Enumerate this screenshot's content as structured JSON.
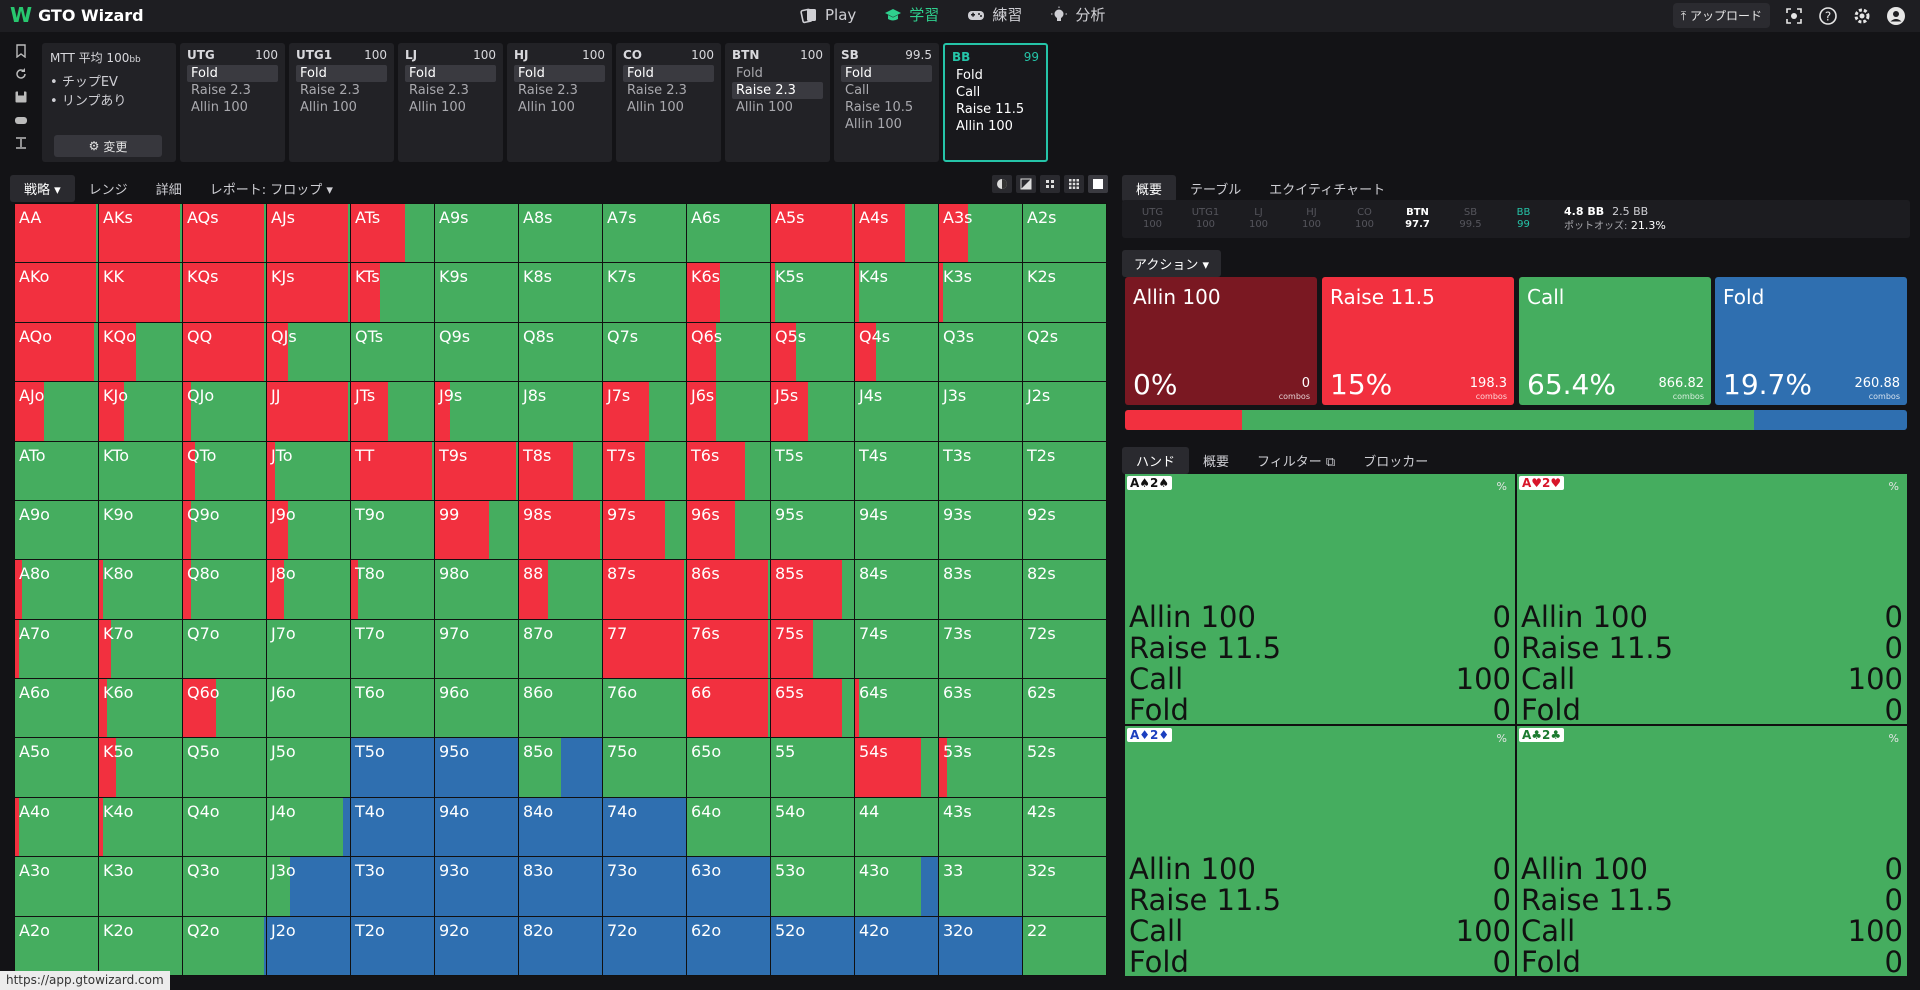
{
  "app": {
    "logo_text": "GTO Wizard"
  },
  "nav": [
    {
      "label": "Play",
      "icon": "cards-icon",
      "active": false
    },
    {
      "label": "学習",
      "icon": "graduation-cap-icon",
      "active": true
    },
    {
      "label": "練習",
      "icon": "gamepad-icon",
      "active": false
    },
    {
      "label": "分析",
      "icon": "bulb-icon",
      "active": false
    }
  ],
  "topright": {
    "upload_label": "アップロード"
  },
  "settings_card": {
    "title": "MTT 平均 100",
    "title_unit": "bb",
    "items": [
      "チップEV",
      "リンプあり"
    ],
    "change_label": "変更"
  },
  "positions": [
    {
      "name": "UTG",
      "stack": "100",
      "actions": [
        "Fold",
        "Raise 2.3",
        "Allin 100"
      ],
      "selected": 0
    },
    {
      "name": "UTG1",
      "stack": "100",
      "actions": [
        "Fold",
        "Raise 2.3",
        "Allin 100"
      ],
      "selected": 0
    },
    {
      "name": "LJ",
      "stack": "100",
      "actions": [
        "Fold",
        "Raise 2.3",
        "Allin 100"
      ],
      "selected": 0
    },
    {
      "name": "HJ",
      "stack": "100",
      "actions": [
        "Fold",
        "Raise 2.3",
        "Allin 100"
      ],
      "selected": 0
    },
    {
      "name": "CO",
      "stack": "100",
      "actions": [
        "Fold",
        "Raise 2.3",
        "Allin 100"
      ],
      "selected": 0
    },
    {
      "name": "BTN",
      "stack": "100",
      "actions": [
        "Fold",
        "Raise 2.3",
        "Allin 100"
      ],
      "selected": 1
    },
    {
      "name": "SB",
      "stack": "99.5",
      "actions": [
        "Fold",
        "Call",
        "Raise 10.5",
        "Allin 100"
      ],
      "selected": 0
    },
    {
      "name": "BB",
      "stack": "99",
      "actions": [
        "Fold",
        "Call",
        "Raise 11.5",
        "Allin 100"
      ],
      "selected": -1,
      "active": true
    }
  ],
  "left_tabs": [
    {
      "label": "戦略 ▾",
      "active": true
    },
    {
      "label": "レンジ",
      "active": false
    },
    {
      "label": "詳細",
      "active": false
    },
    {
      "label": "レポート: フロップ ▾",
      "active": false
    }
  ],
  "matrix": {
    "colors": {
      "raise": "#f2303f",
      "call": "#45ad5f",
      "fold": "#2f6fb0"
    },
    "cells": [
      [
        "AA",
        0.97,
        0
      ],
      [
        "AKs",
        0.97,
        0
      ],
      [
        "AQs",
        0.97,
        0
      ],
      [
        "AJs",
        0.97,
        0
      ],
      [
        "ATs",
        0.65,
        0
      ],
      [
        "A9s",
        0,
        0
      ],
      [
        "A8s",
        0,
        0
      ],
      [
        "A7s",
        0,
        0
      ],
      [
        "A6s",
        0,
        0
      ],
      [
        "A5s",
        0.97,
        0
      ],
      [
        "A4s",
        0.6,
        0
      ],
      [
        "A3s",
        0.35,
        0
      ],
      [
        "A2s",
        0,
        0
      ],
      [
        "AKo",
        0.97,
        0
      ],
      [
        "KK",
        0.97,
        0
      ],
      [
        "KQs",
        0.97,
        0
      ],
      [
        "KJs",
        0.97,
        0
      ],
      [
        "KTs",
        0.35,
        0
      ],
      [
        "K9s",
        0,
        0
      ],
      [
        "K8s",
        0,
        0
      ],
      [
        "K7s",
        0,
        0
      ],
      [
        "K6s",
        0.4,
        0
      ],
      [
        "K5s",
        0.05,
        0
      ],
      [
        "K4s",
        0.05,
        0
      ],
      [
        "K3s",
        0.05,
        0
      ],
      [
        "K2s",
        0,
        0
      ],
      [
        "AQo",
        0.95,
        0
      ],
      [
        "KQo",
        0.45,
        0
      ],
      [
        "QQ",
        0.97,
        0
      ],
      [
        "QJs",
        0.25,
        0
      ],
      [
        "QTs",
        0,
        0
      ],
      [
        "Q9s",
        0,
        0
      ],
      [
        "Q8s",
        0,
        0
      ],
      [
        "Q7s",
        0,
        0
      ],
      [
        "Q6s",
        0.35,
        0
      ],
      [
        "Q5s",
        0.3,
        0
      ],
      [
        "Q4s",
        0.25,
        0
      ],
      [
        "Q3s",
        0,
        0
      ],
      [
        "Q2s",
        0,
        0
      ],
      [
        "AJo",
        0.35,
        0
      ],
      [
        "KJo",
        0.3,
        0
      ],
      [
        "QJo",
        0.1,
        0
      ],
      [
        "JJ",
        0.97,
        0
      ],
      [
        "JTs",
        0.45,
        0
      ],
      [
        "J9s",
        0.18,
        0
      ],
      [
        "J8s",
        0,
        0
      ],
      [
        "J7s",
        0.55,
        0
      ],
      [
        "J6s",
        0.35,
        0
      ],
      [
        "J5s",
        0.45,
        0
      ],
      [
        "J4s",
        0,
        0
      ],
      [
        "J3s",
        0,
        0
      ],
      [
        "J2s",
        0,
        0
      ],
      [
        "ATo",
        0,
        0
      ],
      [
        "KTo",
        0,
        0
      ],
      [
        "QTo",
        0.15,
        0
      ],
      [
        "JTo",
        0.1,
        0
      ],
      [
        "TT",
        0.97,
        0
      ],
      [
        "T9s",
        0.97,
        0
      ],
      [
        "T8s",
        0.65,
        0
      ],
      [
        "T7s",
        0.5,
        0
      ],
      [
        "T6s",
        0.7,
        0
      ],
      [
        "T5s",
        0,
        0
      ],
      [
        "T4s",
        0,
        0
      ],
      [
        "T3s",
        0,
        0
      ],
      [
        "T2s",
        0,
        0
      ],
      [
        "A9o",
        0,
        0
      ],
      [
        "K9o",
        0,
        0
      ],
      [
        "Q9o",
        0.1,
        0
      ],
      [
        "J9o",
        0.25,
        0
      ],
      [
        "T9o",
        0,
        0
      ],
      [
        "99",
        0.65,
        0
      ],
      [
        "98s",
        0.97,
        0
      ],
      [
        "97s",
        0.75,
        0
      ],
      [
        "96s",
        0.58,
        0
      ],
      [
        "95s",
        0,
        0
      ],
      [
        "94s",
        0,
        0
      ],
      [
        "93s",
        0,
        0
      ],
      [
        "92s",
        0,
        0
      ],
      [
        "A8o",
        0.08,
        0
      ],
      [
        "K8o",
        0.05,
        0
      ],
      [
        "Q8o",
        0.1,
        0
      ],
      [
        "J8o",
        0.2,
        0
      ],
      [
        "T8o",
        0.08,
        0
      ],
      [
        "98o",
        0,
        0
      ],
      [
        "88",
        0.35,
        0
      ],
      [
        "87s",
        0.97,
        0
      ],
      [
        "86s",
        0.97,
        0
      ],
      [
        "85s",
        0.85,
        0
      ],
      [
        "84s",
        0,
        0
      ],
      [
        "83s",
        0,
        0
      ],
      [
        "82s",
        0,
        0
      ],
      [
        "A7o",
        0.05,
        0
      ],
      [
        "K7o",
        0.15,
        0
      ],
      [
        "Q7o",
        0,
        0
      ],
      [
        "J7o",
        0,
        0
      ],
      [
        "T7o",
        0,
        0
      ],
      [
        "97o",
        0,
        0
      ],
      [
        "87o",
        0,
        0
      ],
      [
        "77",
        0.97,
        0
      ],
      [
        "76s",
        0.97,
        0
      ],
      [
        "75s",
        0.5,
        0
      ],
      [
        "74s",
        0,
        0
      ],
      [
        "73s",
        0,
        0
      ],
      [
        "72s",
        0,
        0
      ],
      [
        "A6o",
        0,
        0
      ],
      [
        "K6o",
        0.1,
        0
      ],
      [
        "Q6o",
        0.4,
        0
      ],
      [
        "J6o",
        0,
        0
      ],
      [
        "T6o",
        0,
        0
      ],
      [
        "96o",
        0,
        0
      ],
      [
        "86o",
        0,
        0
      ],
      [
        "76o",
        0,
        0
      ],
      [
        "66",
        0.97,
        0
      ],
      [
        "65s",
        0.85,
        0
      ],
      [
        "64s",
        0.05,
        0
      ],
      [
        "63s",
        0,
        0
      ],
      [
        "62s",
        0,
        0
      ],
      [
        "A5o",
        0,
        0
      ],
      [
        "K5o",
        0.2,
        0
      ],
      [
        "Q5o",
        0,
        0
      ],
      [
        "J5o",
        0,
        0
      ],
      [
        "T5o",
        0,
        1
      ],
      [
        "95o",
        0,
        1
      ],
      [
        "85o",
        0,
        0.5
      ],
      [
        "75o",
        0,
        0
      ],
      [
        "65o",
        0,
        0
      ],
      [
        "55",
        0,
        0
      ],
      [
        "54s",
        0.8,
        0
      ],
      [
        "53s",
        0.1,
        0
      ],
      [
        "52s",
        0,
        0
      ],
      [
        "A4o",
        0.05,
        0
      ],
      [
        "K4o",
        0.05,
        0
      ],
      [
        "Q4o",
        0,
        0
      ],
      [
        "J4o",
        0,
        0.08
      ],
      [
        "T4o",
        0,
        1
      ],
      [
        "94o",
        0,
        1
      ],
      [
        "84o",
        0,
        1
      ],
      [
        "74o",
        0,
        1
      ],
      [
        "64o",
        0,
        0
      ],
      [
        "54o",
        0,
        0
      ],
      [
        "44",
        0,
        0
      ],
      [
        "43s",
        0,
        0
      ],
      [
        "42s",
        0,
        0
      ],
      [
        "A3o",
        0,
        0
      ],
      [
        "K3o",
        0,
        0
      ],
      [
        "Q3o",
        0,
        0
      ],
      [
        "J3o",
        0,
        0.72
      ],
      [
        "T3o",
        0,
        1
      ],
      [
        "93o",
        0,
        1
      ],
      [
        "83o",
        0,
        1
      ],
      [
        "73o",
        0,
        1
      ],
      [
        "63o",
        0,
        1
      ],
      [
        "53o",
        0,
        0
      ],
      [
        "43o",
        0,
        0.2
      ],
      [
        "33",
        0,
        0
      ],
      [
        "32s",
        0,
        0
      ],
      [
        "A2o",
        0,
        0
      ],
      [
        "K2o",
        0,
        0
      ],
      [
        "Q2o",
        0,
        0.03
      ],
      [
        "J2o",
        0,
        1
      ],
      [
        "T2o",
        0,
        1
      ],
      [
        "92o",
        0,
        1
      ],
      [
        "82o",
        0,
        1
      ],
      [
        "72o",
        0,
        1
      ],
      [
        "62o",
        0,
        1
      ],
      [
        "52o",
        0,
        1
      ],
      [
        "42o",
        0,
        1
      ],
      [
        "32o",
        0,
        1
      ],
      [
        "22",
        0,
        0
      ]
    ]
  },
  "right_tabs": [
    {
      "label": "概要",
      "active": true
    },
    {
      "label": "テーブル",
      "active": false
    },
    {
      "label": "エクイティチャート",
      "active": false
    }
  ],
  "pos_summary": [
    {
      "name": "UTG",
      "stack": "100",
      "kind": "dim"
    },
    {
      "name": "UTG1",
      "stack": "100",
      "kind": "dim"
    },
    {
      "name": "LJ",
      "stack": "100",
      "kind": "dim"
    },
    {
      "name": "HJ",
      "stack": "100",
      "kind": "dim"
    },
    {
      "name": "CO",
      "stack": "100",
      "kind": "dim"
    },
    {
      "name": "BTN",
      "stack": "97.7",
      "kind": "cur"
    },
    {
      "name": "SB",
      "stack": "99.5",
      "kind": "dim"
    },
    {
      "name": "BB",
      "stack": "99",
      "kind": "bb"
    }
  ],
  "pot": {
    "pot": "4.8 BB",
    "bet": "2.5 BB",
    "odds_label": "ポットオッズ:",
    "odds": "21.3%"
  },
  "action_dropdown": "アクション ▾",
  "actions": [
    {
      "name": "Allin 100",
      "pct": "0%",
      "combos": "0",
      "combos_label": "combos",
      "color": "#7a1822",
      "share": 0
    },
    {
      "name": "Raise 11.5",
      "pct": "15%",
      "combos": "198.3",
      "combos_label": "combos",
      "color": "#f2303f",
      "share": 15
    },
    {
      "name": "Call",
      "pct": "65.4%",
      "combos": "866.82",
      "combos_label": "combos",
      "color": "#45ad5f",
      "share": 65.4
    },
    {
      "name": "Fold",
      "pct": "19.7%",
      "combos": "260.88",
      "combos_label": "combos",
      "color": "#2f6fb0",
      "share": 19.7
    }
  ],
  "hand_tabs": [
    {
      "label": "ハンド",
      "active": true
    },
    {
      "label": "概要",
      "active": false
    },
    {
      "label": "フィルター ⧉",
      "active": false
    },
    {
      "label": "ブロッカー",
      "active": false
    }
  ],
  "combos": [
    {
      "tag": "A♠2♠",
      "suit": "blk",
      "pct_label": "%",
      "rows": [
        [
          "Allin 100",
          "0"
        ],
        [
          "Raise 11.5",
          "0"
        ],
        [
          "Call",
          "100"
        ],
        [
          "Fold",
          "0"
        ]
      ]
    },
    {
      "tag": "A♥2♥",
      "suit": "red",
      "pct_label": "%",
      "rows": [
        [
          "Allin 100",
          "0"
        ],
        [
          "Raise 11.5",
          "0"
        ],
        [
          "Call",
          "100"
        ],
        [
          "Fold",
          "0"
        ]
      ]
    },
    {
      "tag": "A♦2♦",
      "suit": "blu",
      "pct_label": "%",
      "rows": [
        [
          "Allin 100",
          "0"
        ],
        [
          "Raise 11.5",
          "0"
        ],
        [
          "Call",
          "100"
        ],
        [
          "Fold",
          "0"
        ]
      ]
    },
    {
      "tag": "A♣2♣",
      "suit": "grn",
      "pct_label": "%",
      "rows": [
        [
          "Allin 100",
          "0"
        ],
        [
          "Raise 11.5",
          "0"
        ],
        [
          "Call",
          "100"
        ],
        [
          "Fold",
          "0"
        ]
      ]
    }
  ],
  "status_url": "https://app.gtowizard.com"
}
